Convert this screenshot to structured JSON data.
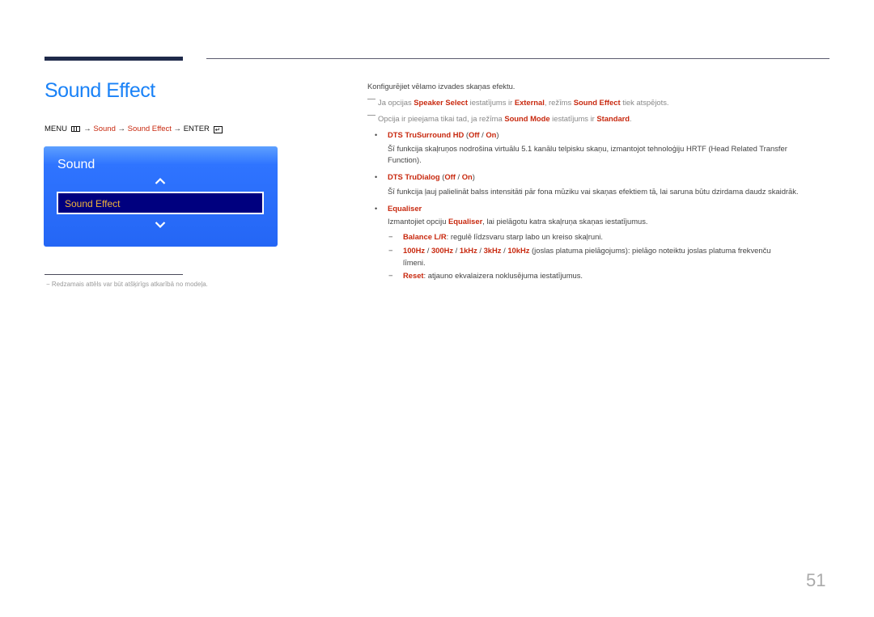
{
  "page": {
    "title": "Sound Effect",
    "page_number": "51",
    "accent_color": "#1a82f7",
    "highlight_color": "#c8290f"
  },
  "menu_path": {
    "menu": "MENU",
    "menu_icon": "menu-grid-icon",
    "arrow": "→",
    "step1": "Sound",
    "step2": "Sound Effect",
    "enter": "ENTER",
    "enter_icon": "enter-return-icon",
    "enter_glyph": "↵"
  },
  "osd": {
    "title": "Sound",
    "selected_item": "Sound Effect",
    "up_icon": "chevron-up-icon",
    "down_icon": "chevron-down-icon"
  },
  "footnote": {
    "dash": "−",
    "text": "Redzamais attēls var būt atšķirīgs atkarībā no modeļa."
  },
  "content": {
    "intro": "Konfigurējiet vēlamo izvades skaņas efektu.",
    "note1": {
      "t1": "Ja opcijas ",
      "b1": "Speaker Select",
      "t2": " iestatījums ir ",
      "b2": "External",
      "t3": ", režīms ",
      "b3": "Sound Effect",
      "t4": " tiek atspējots."
    },
    "note2": {
      "t1": "Opcija ir pieejama tikai tad, ja režīma ",
      "b1": "Sound Mode",
      "t2": " iestatījums ir ",
      "b2": "Standard",
      "t3": "."
    },
    "items": [
      {
        "bullet": "•",
        "name": "DTS TruSurround HD",
        "open": " (",
        "off": "Off",
        "sep": " / ",
        "on": "On",
        "close": ")",
        "desc_line1": "Šī funkcija skaļruņos nodrošina virtuālu 5.1 kanālu telpisku skaņu, izmantojot tehnoloģiju HRTF (Head Related Transfer",
        "desc_line2": "Function)."
      },
      {
        "bullet": "•",
        "name": "DTS TruDialog",
        "open": " (",
        "off": "Off",
        "sep": " / ",
        "on": "On",
        "close": ")",
        "desc_line1": "Šī funkcija ļauj palielināt balss intensitāti pār fona mūziku vai skaņas efektiem tā, lai saruna būtu dzirdama daudz skaidrāk."
      },
      {
        "bullet": "•",
        "name": "Equaliser",
        "desc_t1": "Izmantojiet opciju ",
        "desc_b1": "Equaliser",
        "desc_t2": ", lai pielāgotu katra skaļruņa skaņas iestatījumus.",
        "sub": [
          {
            "dash": "−",
            "b1": "Balance L/R",
            "t1": ": regulē līdzsvaru starp labo un kreiso skaļruni."
          },
          {
            "dash": "−",
            "bands": [
              "100Hz",
              "300Hz",
              "1kHz",
              "3kHz",
              "10kHz"
            ],
            "sep": " / ",
            "t1": " (joslas platuma pielāgojums): pielāgo noteiktu joslas platuma frekvenču",
            "t2": "līmeni."
          },
          {
            "dash": "−",
            "b1": "Reset",
            "t1": ": atjauno ekvalaizera noklusējuma iestatījumus."
          }
        ]
      }
    ]
  }
}
